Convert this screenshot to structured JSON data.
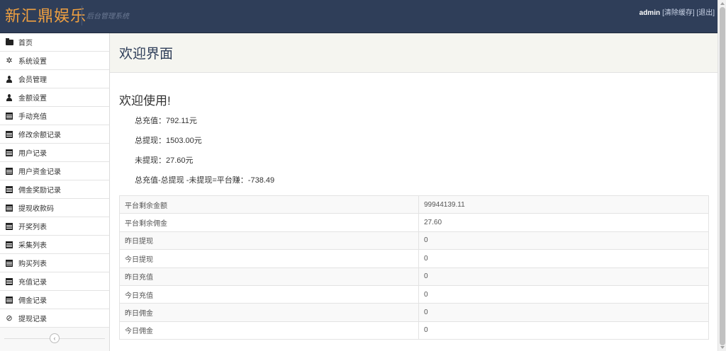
{
  "navbar": {
    "brand": "新汇鼎娱乐",
    "subtitle": "后台管理系统",
    "user": "admin",
    "clear_cache": "[清除缓存]",
    "logout": "[退出]"
  },
  "sidebar": {
    "items": [
      {
        "label": "首页",
        "icon": "folder-open-icon"
      },
      {
        "label": "系统设置",
        "icon": "gear-icon"
      },
      {
        "label": "会员管理",
        "icon": "user-icon"
      },
      {
        "label": "金额设置",
        "icon": "user-icon"
      },
      {
        "label": "手动充值",
        "icon": "calendar-icon"
      },
      {
        "label": "修改余额记录",
        "icon": "calendar-icon"
      },
      {
        "label": "用户记录",
        "icon": "calendar-icon"
      },
      {
        "label": "用户资金记录",
        "icon": "calendar-icon"
      },
      {
        "label": "佣金奖励记录",
        "icon": "calendar-icon"
      },
      {
        "label": "提现收款码",
        "icon": "calendar-icon"
      },
      {
        "label": "开奖列表",
        "icon": "calendar-icon"
      },
      {
        "label": "采集列表",
        "icon": "calendar-icon"
      },
      {
        "label": "购买列表",
        "icon": "calendar-icon"
      },
      {
        "label": "充值记录",
        "icon": "calendar-icon"
      },
      {
        "label": "佣金记录",
        "icon": "calendar-icon"
      },
      {
        "label": "提现记录",
        "icon": "ban-icon"
      }
    ],
    "collapse": "‹"
  },
  "main": {
    "page_title": "欢迎界面",
    "welcome": "欢迎使用!",
    "stats": [
      "总充值：792.11元",
      "总提现：1503.00元",
      "未提现：27.60元",
      "总充值-总提现 -未提现=平台赚：-738.49"
    ],
    "table": [
      {
        "key": "平台剩余金额",
        "value": "99944139.11"
      },
      {
        "key": "平台剩余佣金",
        "value": "27.60"
      },
      {
        "key": "昨日提现",
        "value": "0"
      },
      {
        "key": "今日提现",
        "value": "0"
      },
      {
        "key": "昨日充值",
        "value": "0"
      },
      {
        "key": "今日充值",
        "value": "0"
      },
      {
        "key": "昨日佣金",
        "value": "0"
      },
      {
        "key": "今日佣金",
        "value": "0"
      }
    ]
  },
  "colors": {
    "navbar_bg": "#2f3e59",
    "brand": "#f0a040",
    "header_bg": "#f5f5f0"
  }
}
